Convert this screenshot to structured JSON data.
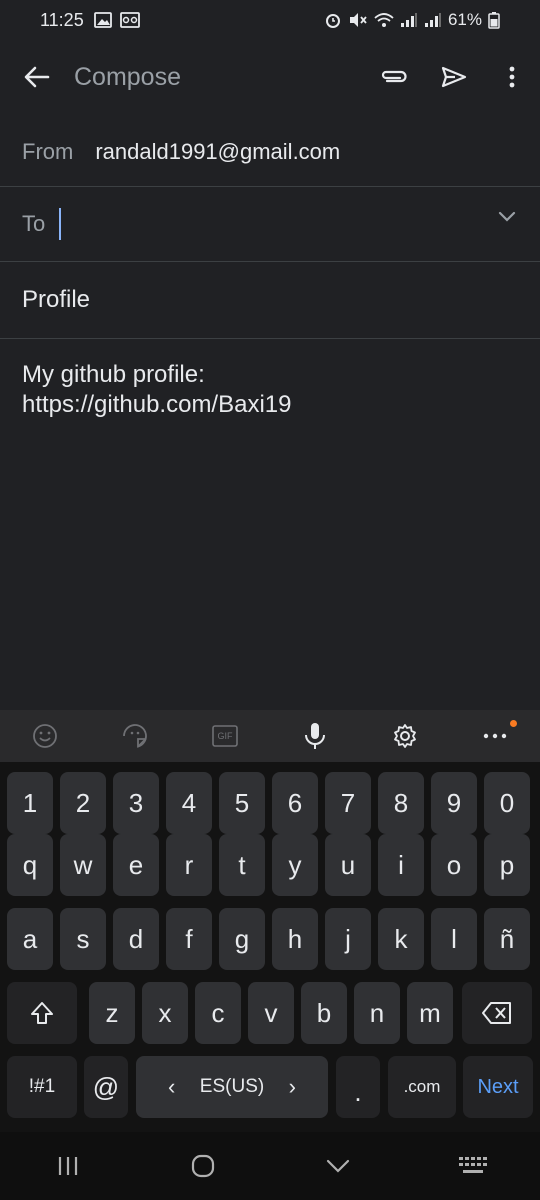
{
  "status_bar": {
    "time": "11:25",
    "battery": "61%",
    "icons_left": [
      "image-icon",
      "voicemail-icon"
    ],
    "icons_right": [
      "alarm-icon",
      "mute-icon",
      "wifi-icon",
      "signal-icon",
      "signal-icon",
      "battery-icon"
    ]
  },
  "app_bar": {
    "title": "Compose",
    "icons": [
      "back-arrow-icon",
      "attach-icon",
      "send-icon",
      "more-vert-icon"
    ]
  },
  "from": {
    "label": "From",
    "value": "randald1991@gmail.com"
  },
  "to": {
    "label": "To",
    "value": ""
  },
  "subject": {
    "value": "Profile"
  },
  "body": {
    "line1": "My github profile:",
    "line2": "https://github.com/Baxi19"
  },
  "keyboard": {
    "toolbar_icons": [
      "emoji-icon",
      "sticker-icon",
      "gif-icon",
      "mic-icon",
      "settings-icon",
      "more-horiz-icon"
    ],
    "gif_label": "GIF",
    "number_row": [
      "1",
      "2",
      "3",
      "4",
      "5",
      "6",
      "7",
      "8",
      "9",
      "0"
    ],
    "row1": [
      "q",
      "w",
      "e",
      "r",
      "t",
      "y",
      "u",
      "i",
      "o",
      "p"
    ],
    "row2": [
      "a",
      "s",
      "d",
      "f",
      "g",
      "h",
      "j",
      "k",
      "l",
      "ñ"
    ],
    "row3": [
      "z",
      "x",
      "c",
      "v",
      "b",
      "n",
      "m"
    ],
    "bottom": {
      "symbols": "!#1",
      "at": "@",
      "language": "ES(US)",
      "lang_left": "‹",
      "lang_right": "›",
      "dot": ".",
      "dotcom": ".com",
      "next": "Next"
    },
    "accent_color": "#5b9ef8"
  },
  "nav_bar": {
    "icons": [
      "recent-apps-icon",
      "home-icon",
      "back-icon",
      "keyboard-icon"
    ]
  }
}
